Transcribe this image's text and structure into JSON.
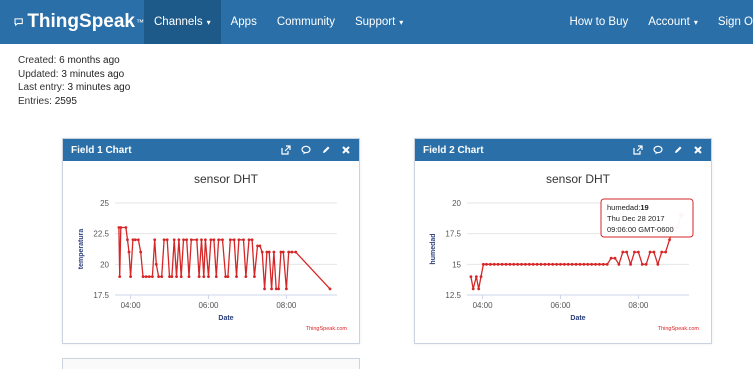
{
  "nav": {
    "brand": "ThingSpeak",
    "brand_mark": "™",
    "items": [
      {
        "label": "Channels",
        "caret": "▾"
      },
      {
        "label": "Apps",
        "caret": ""
      },
      {
        "label": "Community",
        "caret": ""
      },
      {
        "label": "Support",
        "caret": "▾"
      }
    ],
    "right_items": [
      {
        "label": "How to Buy",
        "caret": ""
      },
      {
        "label": "Account",
        "caret": "▾"
      },
      {
        "label": "Sign O",
        "caret": ""
      }
    ]
  },
  "channel_meta": [
    {
      "label": "Created:",
      "value": "6 months ago"
    },
    {
      "label": "Updated:",
      "value": "3 minutes ago"
    },
    {
      "label": "Last entry:",
      "value": "3 minutes ago"
    },
    {
      "label": "Entries:",
      "value": "2595"
    }
  ],
  "colors": {
    "navbar": "#2a6fa8",
    "series": "#d62728",
    "grid": "#e6e6e6"
  },
  "panels": [
    {
      "title": "Field 1 Chart"
    },
    {
      "title": "Field 2 Chart"
    }
  ],
  "chart_data": [
    {
      "type": "line",
      "title": "sensor DHT",
      "xlabel": "Date",
      "ylabel": "temperatura",
      "credit": "ThingSpeak.com",
      "x_ticks": [
        "04:00",
        "06:00",
        "08:00"
      ],
      "y_ticks": [
        17.5,
        20,
        22.5,
        25
      ],
      "xlim": [
        3.6,
        9.3
      ],
      "ylim": [
        17.5,
        25
      ],
      "x_unit": "hours",
      "series": [
        {
          "values": [
            [
              3.7,
              23
            ],
            [
              3.72,
              19
            ],
            [
              3.75,
              23
            ],
            [
              3.88,
              23
            ],
            [
              3.92,
              22
            ],
            [
              3.96,
              21
            ],
            [
              4.0,
              19
            ],
            [
              4.06,
              22
            ],
            [
              4.12,
              22
            ],
            [
              4.2,
              22
            ],
            [
              4.26,
              21
            ],
            [
              4.32,
              19
            ],
            [
              4.4,
              19
            ],
            [
              4.48,
              19
            ],
            [
              4.56,
              19
            ],
            [
              4.62,
              22
            ],
            [
              4.66,
              20
            ],
            [
              4.72,
              19
            ],
            [
              4.8,
              19
            ],
            [
              4.86,
              22
            ],
            [
              4.94,
              22
            ],
            [
              5.0,
              19
            ],
            [
              5.06,
              19
            ],
            [
              5.12,
              22
            ],
            [
              5.18,
              19
            ],
            [
              5.24,
              22
            ],
            [
              5.3,
              19
            ],
            [
              5.36,
              22
            ],
            [
              5.44,
              22
            ],
            [
              5.5,
              19
            ],
            [
              5.56,
              22
            ],
            [
              5.7,
              22
            ],
            [
              5.76,
              19
            ],
            [
              5.82,
              22
            ],
            [
              5.88,
              19
            ],
            [
              5.92,
              22
            ],
            [
              6.0,
              19
            ],
            [
              6.06,
              22
            ],
            [
              6.14,
              22
            ],
            [
              6.2,
              19
            ],
            [
              6.26,
              22
            ],
            [
              6.36,
              22
            ],
            [
              6.44,
              19
            ],
            [
              6.5,
              19
            ],
            [
              6.56,
              22
            ],
            [
              6.66,
              22
            ],
            [
              6.72,
              19
            ],
            [
              6.78,
              22
            ],
            [
              6.9,
              22
            ],
            [
              6.96,
              19
            ],
            [
              7.04,
              22
            ],
            [
              7.12,
              22
            ],
            [
              7.18,
              19
            ],
            [
              7.26,
              21.5
            ],
            [
              7.32,
              21.5
            ],
            [
              7.38,
              21
            ],
            [
              7.44,
              18
            ],
            [
              7.5,
              21
            ],
            [
              7.56,
              21
            ],
            [
              7.62,
              18
            ],
            [
              7.68,
              21
            ],
            [
              7.74,
              18
            ],
            [
              7.8,
              18
            ],
            [
              7.86,
              21
            ],
            [
              7.92,
              21
            ],
            [
              8.0,
              18
            ],
            [
              8.06,
              21
            ],
            [
              8.14,
              21
            ],
            [
              8.24,
              21
            ],
            [
              9.12,
              18
            ]
          ]
        }
      ]
    },
    {
      "type": "line",
      "title": "sensor DHT",
      "xlabel": "Date",
      "ylabel": "humedad",
      "credit": "ThingSpeak.com",
      "x_ticks": [
        "04:00",
        "06:00",
        "08:00"
      ],
      "y_ticks": [
        12.5,
        15,
        17.5,
        20
      ],
      "xlim": [
        3.6,
        9.3
      ],
      "ylim": [
        12.5,
        20
      ],
      "x_unit": "hours",
      "tooltip": {
        "series_label": "humedad:",
        "series_value": "19",
        "date": "Thu Dec 28 2017",
        "time": "09:06:00 GMT-0600"
      },
      "series": [
        {
          "values": [
            [
              3.7,
              14
            ],
            [
              3.76,
              13
            ],
            [
              3.84,
              14
            ],
            [
              3.9,
              13
            ],
            [
              3.96,
              14
            ],
            [
              4.02,
              15
            ],
            [
              4.1,
              15
            ],
            [
              4.2,
              15
            ],
            [
              4.3,
              15
            ],
            [
              4.4,
              15
            ],
            [
              4.5,
              15
            ],
            [
              4.6,
              15
            ],
            [
              4.7,
              15
            ],
            [
              4.8,
              15
            ],
            [
              4.9,
              15
            ],
            [
              5.0,
              15
            ],
            [
              5.1,
              15
            ],
            [
              5.2,
              15
            ],
            [
              5.3,
              15
            ],
            [
              5.4,
              15
            ],
            [
              5.5,
              15
            ],
            [
              5.6,
              15
            ],
            [
              5.7,
              15
            ],
            [
              5.8,
              15
            ],
            [
              5.9,
              15
            ],
            [
              6.0,
              15
            ],
            [
              6.1,
              15
            ],
            [
              6.2,
              15
            ],
            [
              6.3,
              15
            ],
            [
              6.4,
              15
            ],
            [
              6.5,
              15
            ],
            [
              6.6,
              15
            ],
            [
              6.7,
              15
            ],
            [
              6.8,
              15
            ],
            [
              6.9,
              15
            ],
            [
              7.0,
              15
            ],
            [
              7.1,
              15
            ],
            [
              7.2,
              15
            ],
            [
              7.3,
              15.5
            ],
            [
              7.4,
              15.5
            ],
            [
              7.5,
              15
            ],
            [
              7.6,
              16
            ],
            [
              7.7,
              16
            ],
            [
              7.8,
              15
            ],
            [
              7.9,
              16
            ],
            [
              8.0,
              16
            ],
            [
              8.1,
              15
            ],
            [
              8.2,
              15
            ],
            [
              8.3,
              16
            ],
            [
              8.4,
              16
            ],
            [
              8.5,
              15
            ],
            [
              8.6,
              16
            ],
            [
              8.7,
              16
            ],
            [
              8.8,
              17
            ],
            [
              8.9,
              18
            ],
            [
              9.0,
              18
            ],
            [
              9.1,
              19
            ]
          ]
        }
      ]
    }
  ]
}
